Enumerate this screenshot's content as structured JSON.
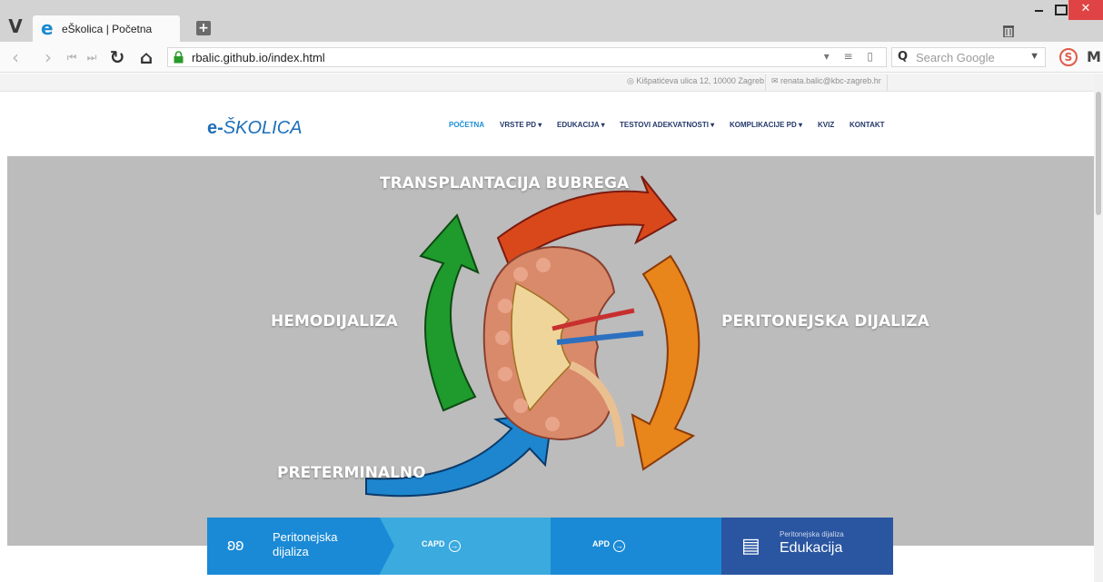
{
  "browser": {
    "tab_title": "eŠkolica | Početna",
    "new_tab_label": "+",
    "url": "rbalic.github.io/index.html",
    "url_tools": "▾ ≡ ▯",
    "search_placeholder": "Search Google",
    "icons": [
      "vivaldi-logo-icon",
      "back-icon",
      "forward-icon",
      "rewind-icon",
      "fast-forward-icon",
      "reload-icon",
      "home-icon",
      "lock-icon",
      "search-icon",
      "trash-icon",
      "extension-icon",
      "mail-icon"
    ]
  },
  "topbar": {
    "address": "Kišpatićeva ulica 12, 10000 Zagreb",
    "email": "renata.balic@kbc-zagreb.hr"
  },
  "header": {
    "logo_prefix": "e-",
    "logo_main": "ŠKOLICA",
    "nav": [
      {
        "label": "POČETNA",
        "active": true
      },
      {
        "label": "VRSTE PD ▾",
        "active": false
      },
      {
        "label": "EDUKACIJA ▾",
        "active": false
      },
      {
        "label": "TESTOVI ADEKVATNOSTI ▾",
        "active": false
      },
      {
        "label": "KOMPLIKACIJE PD ▾",
        "active": false
      },
      {
        "label": "KVIZ",
        "active": false
      },
      {
        "label": "KONTAKT",
        "active": false
      }
    ]
  },
  "hero": {
    "labels": {
      "top": "TRANSPLANTACIJA BUBREGA",
      "left": "HEMODIJALIZA",
      "right": "PERITONEJSKA DIJALIZA",
      "bottom": "PRETERMINALNO"
    }
  },
  "features": {
    "pd_line1": "Peritonejska",
    "pd_line2": "dijaliza",
    "capd": "CAPD",
    "apd": "APD",
    "edu_small": "Peritonejska dijaliza",
    "edu_big": "Edukacija"
  },
  "colors": {
    "brand_blue": "#1d6fb8",
    "hero_bg": "#bcbcbc",
    "arrow_red": "#d9481a",
    "arrow_orange": "#e8851b",
    "arrow_green": "#1f9a2c",
    "arrow_blue": "#1d86cf",
    "edu_blue": "#2a55a0"
  }
}
